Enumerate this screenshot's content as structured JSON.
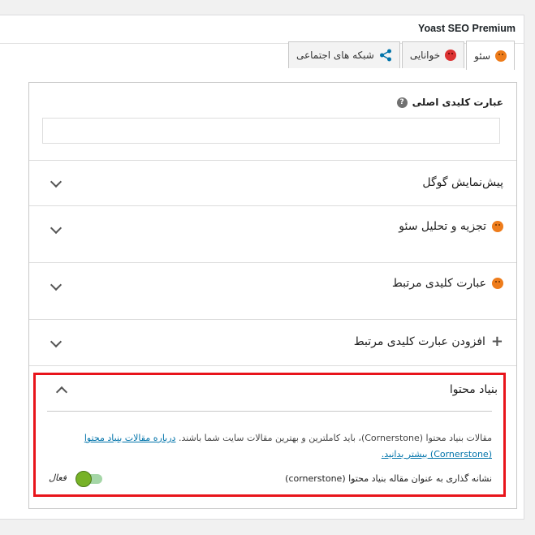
{
  "metabox": {
    "title": "Yoast SEO Premium"
  },
  "tabs": [
    {
      "label": "سئو",
      "icon": "orange-face-icon",
      "active": true
    },
    {
      "label": "خوانایی",
      "icon": "red-sad-face-icon",
      "active": false
    },
    {
      "label": "شبکه های اجتماعی",
      "icon": "share-icon",
      "active": false
    }
  ],
  "focus_keyphrase": {
    "label": "عبارت کلیدی اصلی",
    "help_symbol": "?",
    "value": ""
  },
  "sections": {
    "google_preview": {
      "title": "پیش‌نمایش گوگل"
    },
    "seo_analysis": {
      "title": "تجزیه و تحلیل سئو"
    },
    "related_keyphrase": {
      "title": "عبارت کلیدی مرتبط"
    },
    "add_related_keyphrase": {
      "title": "افزودن عبارت کلیدی مرتبط",
      "plus_symbol": "+"
    }
  },
  "cornerstone": {
    "title": "بنیاد محتوا",
    "description": "مقالات بنیاد محتوا (Cornerstone)، باید کاملترین و بهترین مقالات سایت شما باشند.",
    "link_text": "درباره مقالات بنیاد محتوا (Cornerstone) بیشتر بدانید.",
    "toggle_label": "نشانه گذاری به عنوان مقاله بنیاد محتوا (cornerstone)",
    "toggle_state": "فعال",
    "toggle_on": true
  },
  "colors": {
    "highlight_border": "#e8141b",
    "toggle_on": "#77b227",
    "link": "#0073aa",
    "score_orange": "#ee7c1b",
    "score_red": "#dc3232"
  }
}
